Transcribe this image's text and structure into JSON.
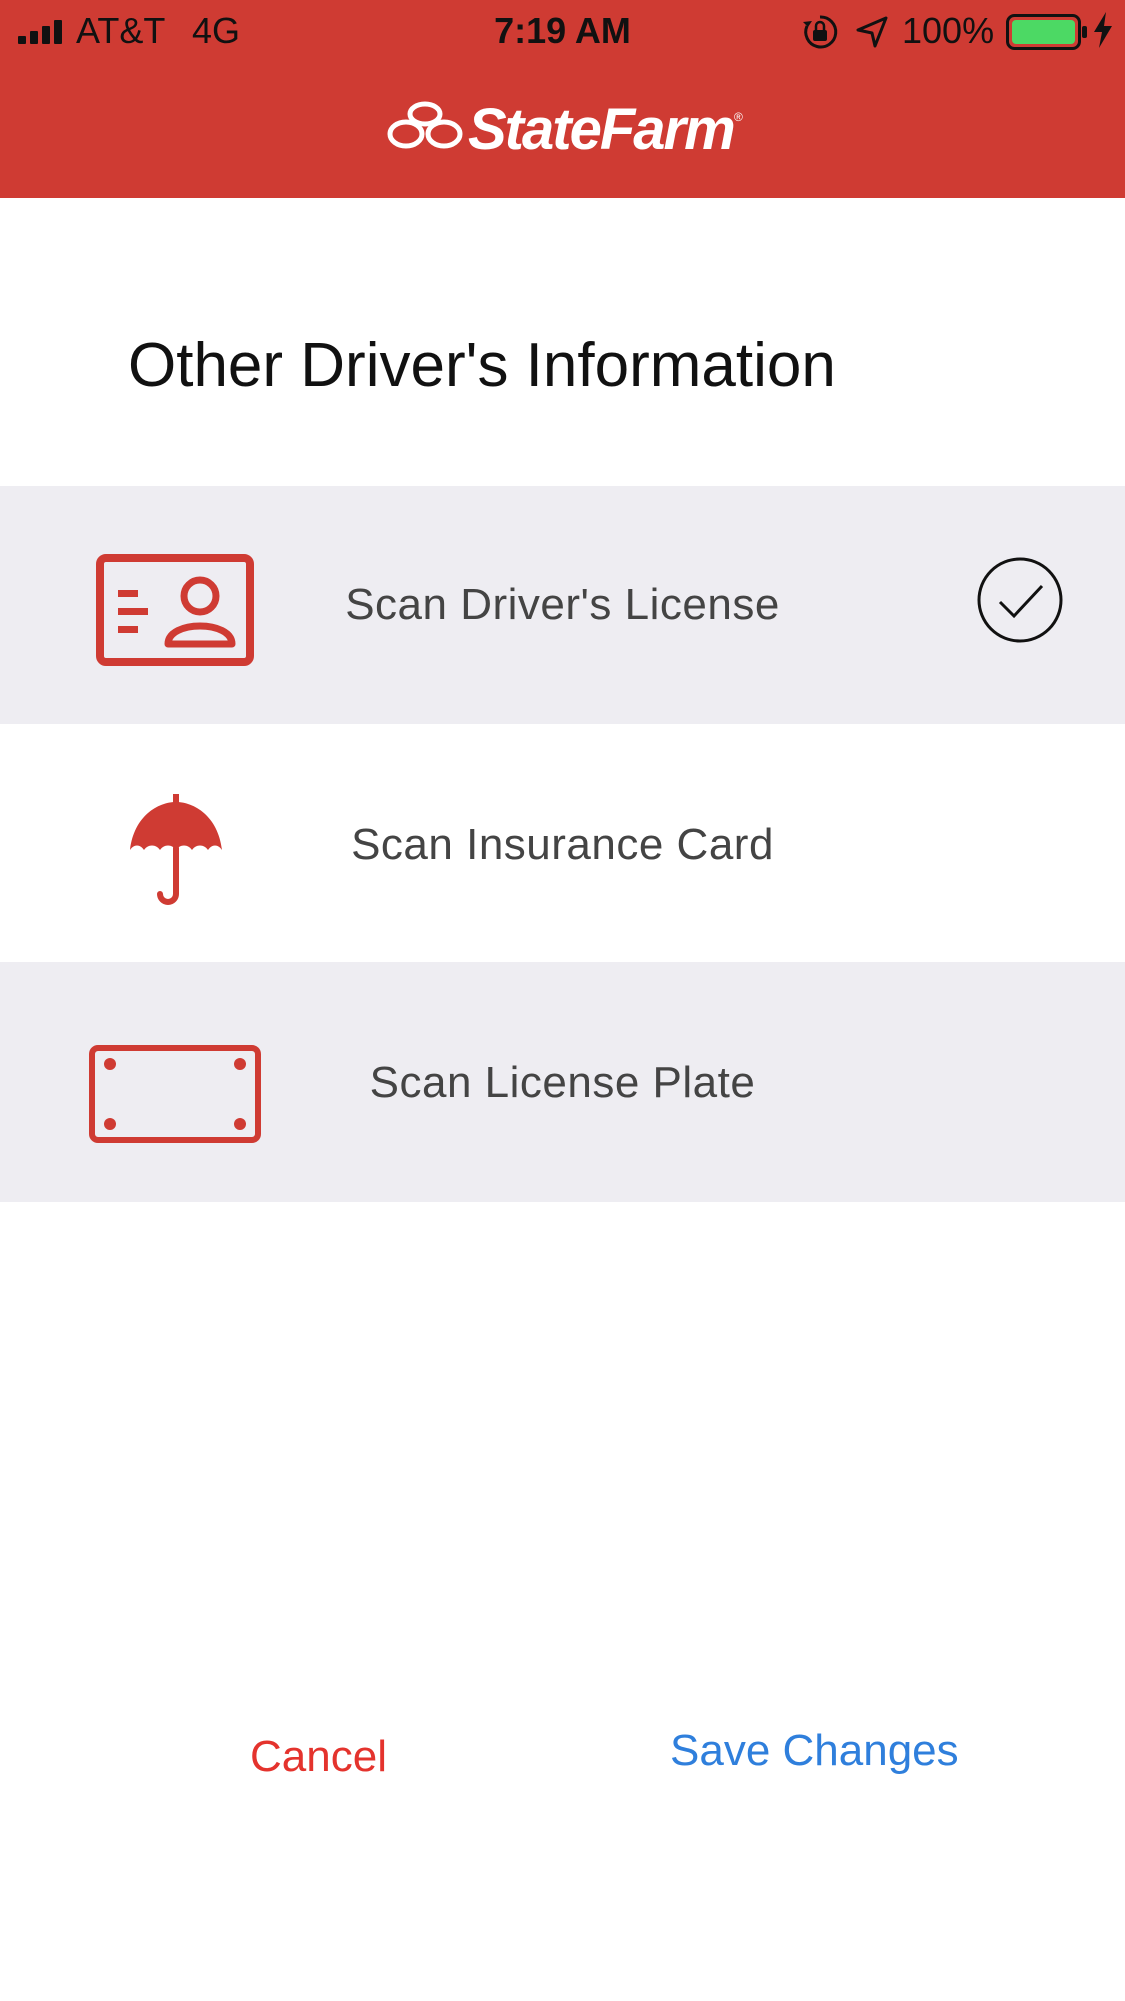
{
  "status_bar": {
    "carrier": "AT&T",
    "network": "4G",
    "time": "7:19 AM",
    "battery_pct": "100%"
  },
  "header": {
    "brand": "StateFarm",
    "reg_mark": "®"
  },
  "page": {
    "title": "Other Driver's Information"
  },
  "options": [
    {
      "label": "Scan Driver's License",
      "icon": "id-card-icon",
      "completed": true
    },
    {
      "label": "Scan Insurance Card",
      "icon": "umbrella-icon",
      "completed": false
    },
    {
      "label": "Scan License Plate",
      "icon": "license-plate-icon",
      "completed": false
    }
  ],
  "actions": {
    "cancel_label": "Cancel",
    "save_label": "Save Changes"
  },
  "colors": {
    "brand_red": "#cf3b33",
    "row_shade": "#eeedf2",
    "cancel": "#e4332d",
    "save": "#2f7fdc",
    "battery_green": "#4cd964"
  }
}
